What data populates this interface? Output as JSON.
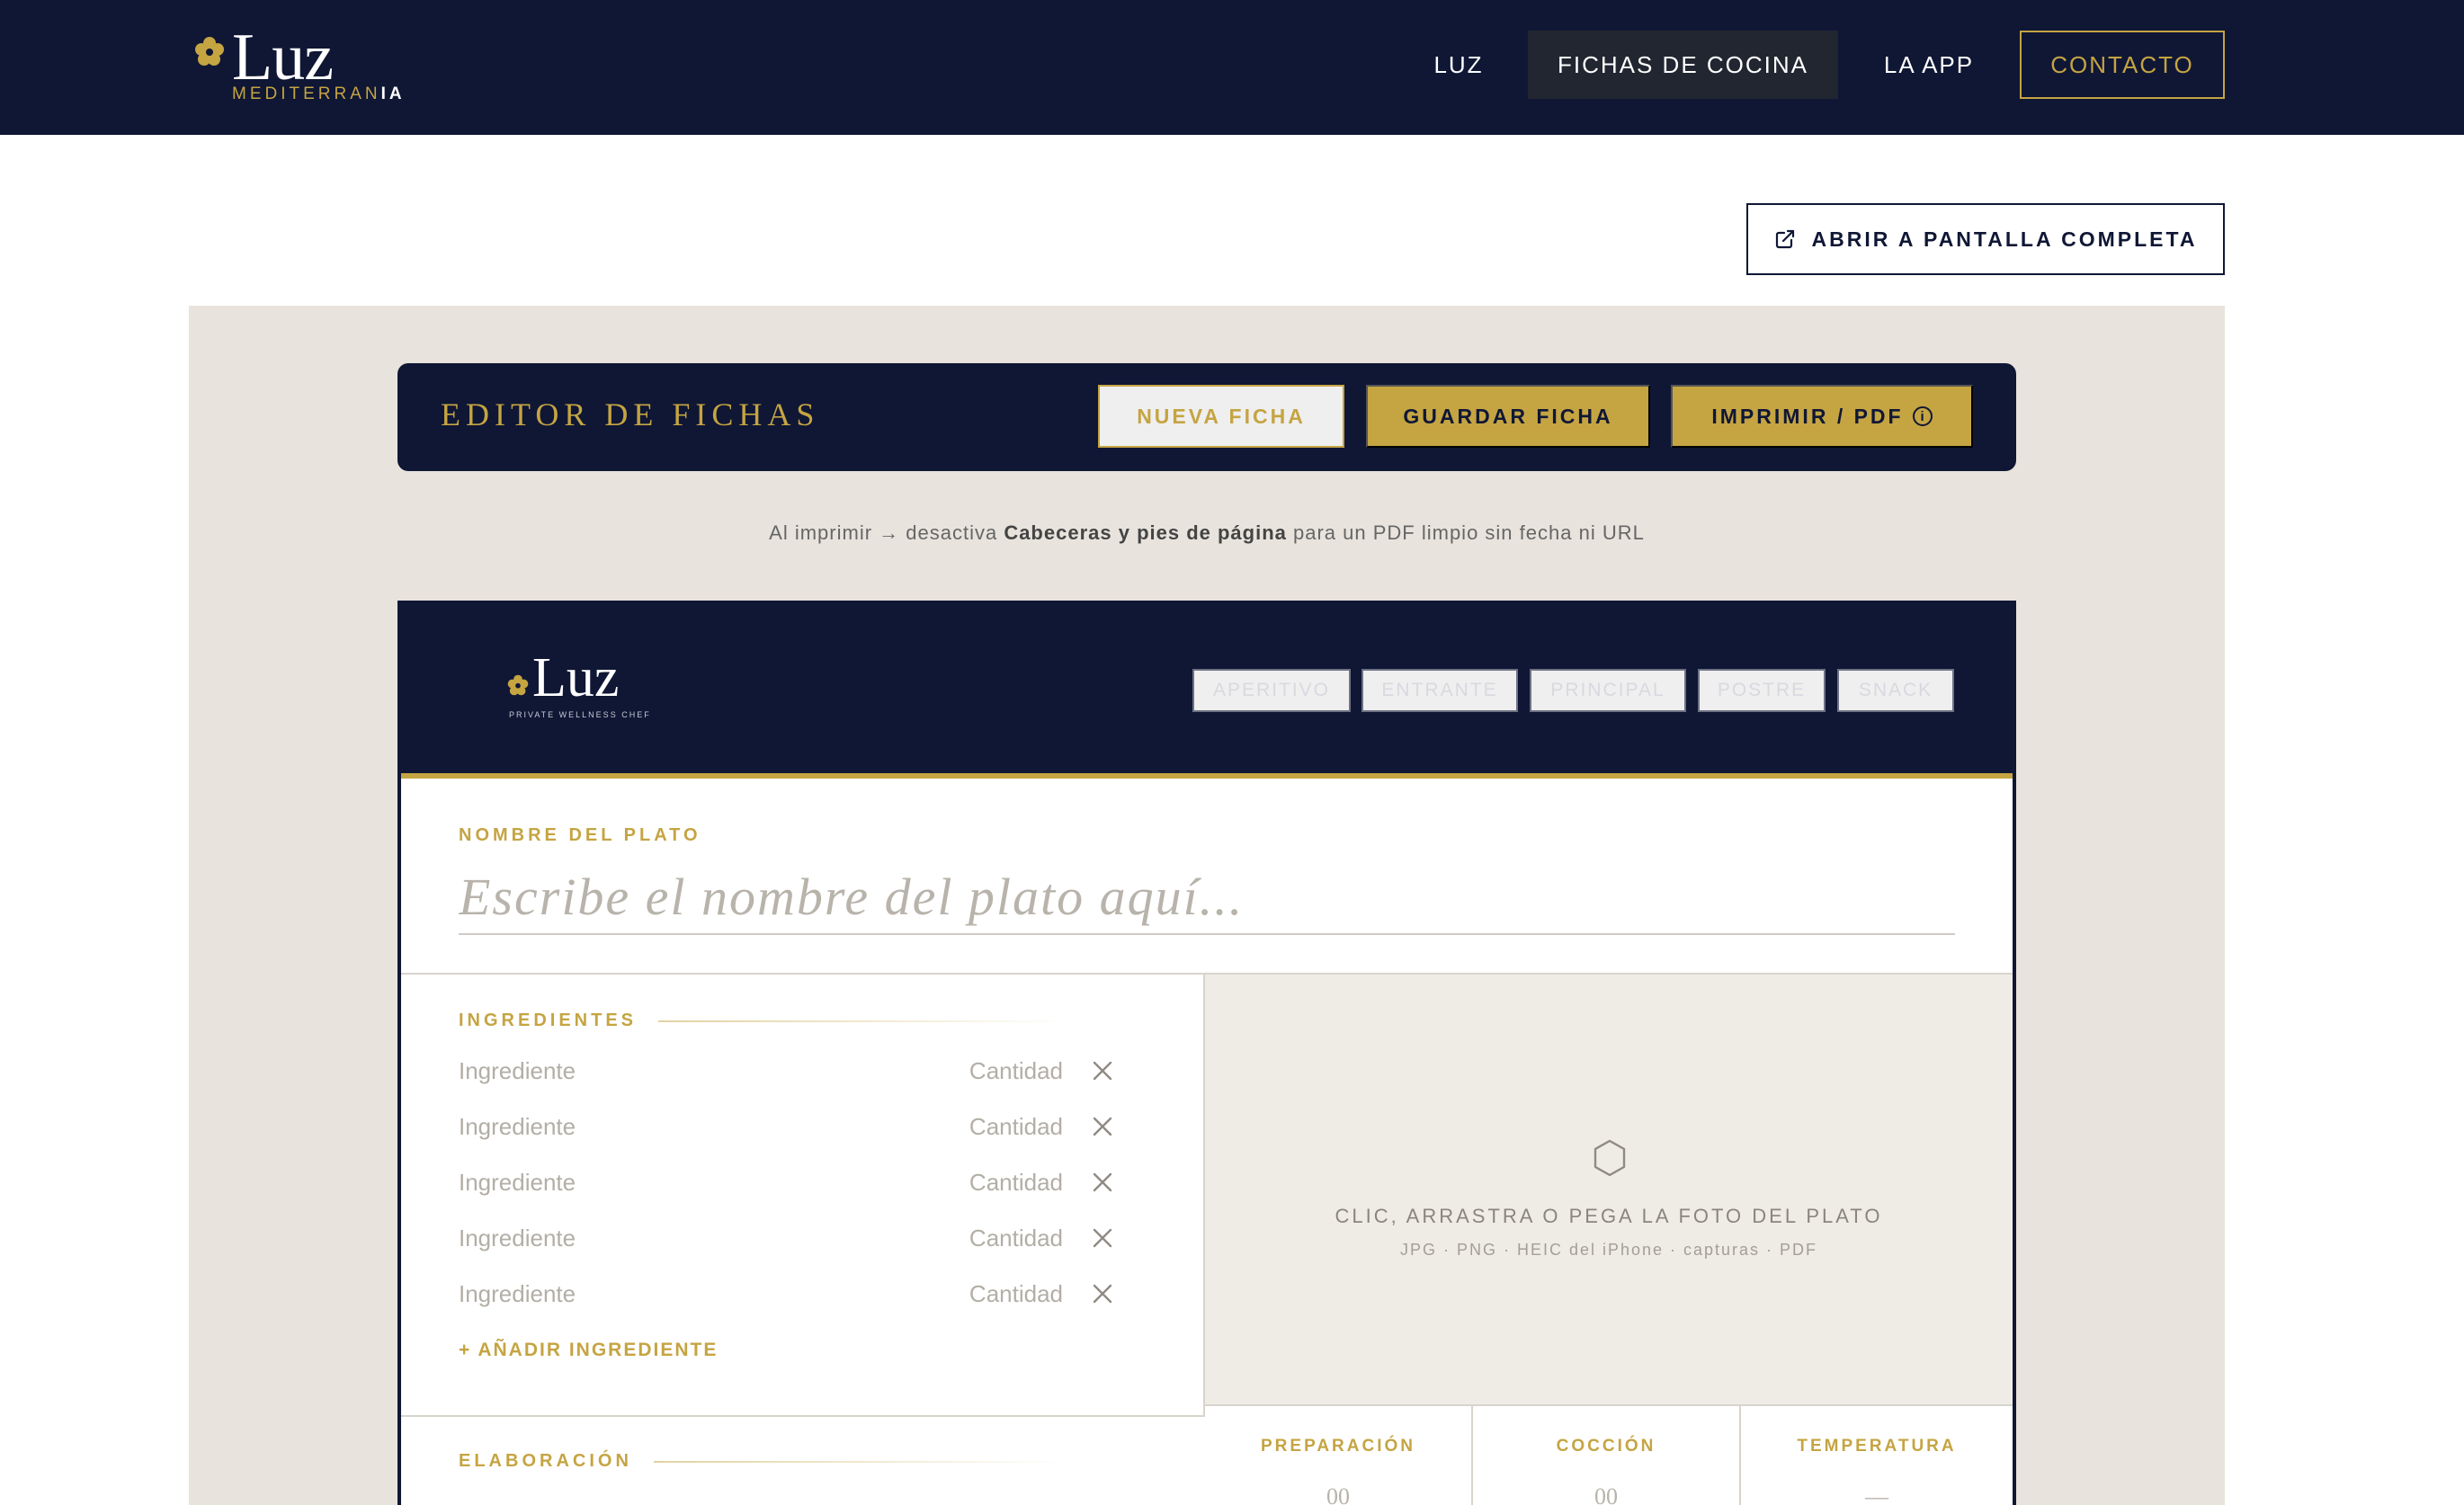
{
  "brand": {
    "name": "Luz",
    "subtitle_main": "MEDITERRAN",
    "subtitle_accent": "IA"
  },
  "nav": {
    "items": [
      "LUZ",
      "FICHAS DE COCINA",
      "LA APP"
    ],
    "cta": "CONTACTO",
    "active": "FICHAS DE COCINA"
  },
  "fullscreen_label": "ABRIR A PANTALLA COMPLETA",
  "editor": {
    "title": "EDITOR DE FICHAS",
    "new_label": "NUEVA FICHA",
    "save_label": "GUARDAR FICHA",
    "print_label": "IMPRIMIR / PDF",
    "print_info_glyph": "i"
  },
  "hint": {
    "before": "Al imprimir → desactiva ",
    "bold": "Cabeceras y pies de página",
    "after": " para un PDF limpio sin fecha ni URL"
  },
  "card": {
    "logo": {
      "name": "Luz",
      "tagline": "PRIVATE WELLNESS CHEF"
    },
    "categories": [
      "APERITIVO",
      "ENTRANTE",
      "PRINCIPAL",
      "POSTRE",
      "SNACK"
    ],
    "dish_label": "NOMBRE DEL PLATO",
    "dish_placeholder": "Escribe el nombre del plato aquí...",
    "ingredients_label": "INGREDIENTES",
    "ingredient_placeholder": "Ingrediente",
    "quantity_placeholder": "Cantidad",
    "ingredient_rows": 5,
    "add_ingredient": "+ AÑADIR INGREDIENTE",
    "elaboration_label": "ELABORACIÓN",
    "photo_prompt": "CLIC, ARRASTRA O PEGA LA FOTO DEL PLATO",
    "photo_formats": "JPG · PNG · HEIC del iPhone · capturas · PDF",
    "meta": [
      {
        "label": "PREPARACIÓN",
        "value": "00"
      },
      {
        "label": "COCCIÓN",
        "value": "00"
      },
      {
        "label": "TEMPERATURA",
        "value": "—"
      }
    ]
  },
  "colors": {
    "navy": "#0f1735",
    "gold": "#c5a442",
    "beige": "#e8e3dc",
    "photo_bg": "#efece6"
  },
  "icons": {
    "brand_flower": "flower-icon",
    "fullscreen": "external-link-icon",
    "remove": "close-icon",
    "photo": "hexagon-icon"
  }
}
